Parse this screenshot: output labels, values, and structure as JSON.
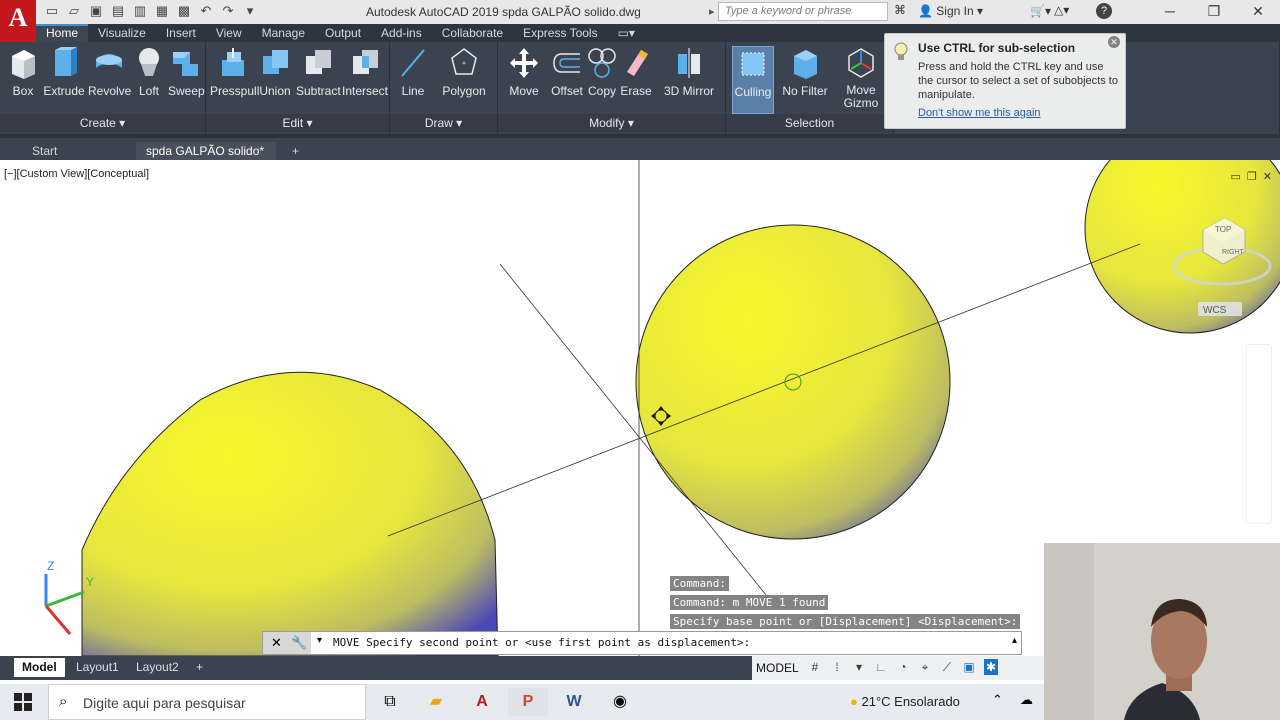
{
  "app": {
    "logo": "A",
    "title": "Autodesk AutoCAD 2019    spda GALPÃO solido.dwg",
    "search_placeholder": "Type a keyword or phrase",
    "sign_in": "Sign In"
  },
  "menu_tabs": [
    "Home",
    "Visualize",
    "Insert",
    "View",
    "Manage",
    "Output",
    "Add-ins",
    "Collaborate",
    "Express Tools"
  ],
  "ribbon": {
    "tools": {
      "box": "Box",
      "extrude": "Extrude",
      "revolve": "Revolve",
      "loft": "Loft",
      "sweep": "Sweep",
      "presspull": "Presspull",
      "union": "Union",
      "subtract": "Subtract",
      "intersect": "Intersect",
      "line": "Line",
      "polygon": "Polygon",
      "move": "Move",
      "offset": "Offset",
      "copy": "Copy",
      "erase": "Erase",
      "mirror3d": "3D Mirror",
      "culling": "Culling",
      "nofilter": "No Filter",
      "movegizmo": "Move Gizmo"
    },
    "panels": {
      "create": "Create ▾",
      "edit": "Edit ▾",
      "draw": "Draw ▾",
      "modify": "Modify ▾",
      "selection": "Selection"
    }
  },
  "tooltip": {
    "title": "Use CTRL for sub-selection",
    "body": "Press and hold the CTRL key and use the cursor to select a set of subobjects to manipulate.",
    "link": "Don't show me this again"
  },
  "doc_tabs": {
    "start": "Start",
    "active": "spda GALPÃO solido*"
  },
  "viewport": {
    "label": "[−][Custom View][Conceptual]",
    "viewcube_top": "TOP",
    "viewcube_right": "RIGHT",
    "wcs": "WCS",
    "ucs_z": "Z",
    "ucs_y": "Y"
  },
  "command": {
    "history": [
      "Command:",
      "Command: m MOVE 1 found",
      "Specify base point or [Displacement] <Displacement>:"
    ],
    "prompt": "MOVE Specify second point or <use first point as displacement>:"
  },
  "layout_tabs": [
    "Model",
    "Layout1",
    "Layout2"
  ],
  "status": {
    "model": "MODEL"
  },
  "taskbar": {
    "search": "Digite aqui para pesquisar",
    "weather": "21°C  Ensolarado"
  },
  "colors": {
    "ribbon": "#3b4350",
    "sphere": "#f2f23a",
    "accent": "#3d8fd1"
  }
}
